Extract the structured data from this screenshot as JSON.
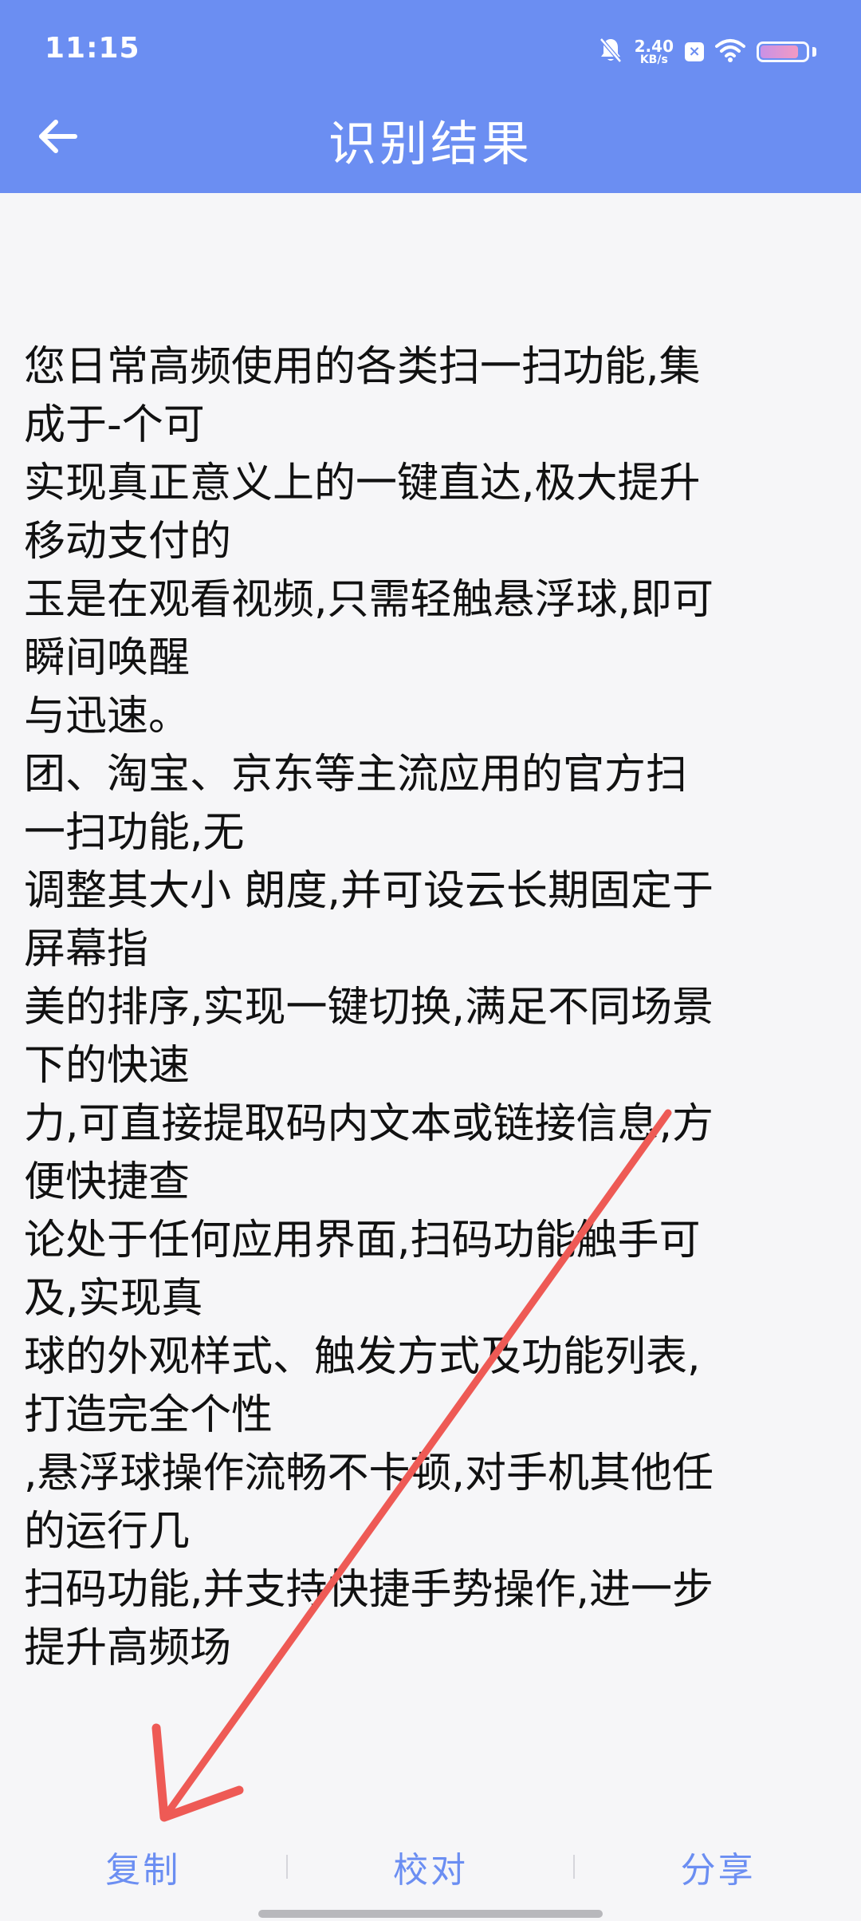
{
  "status_bar": {
    "time": "11:15",
    "net_speed_value": "2.40",
    "net_speed_unit": "KB/s",
    "x_badge": "×",
    "icons": [
      "bell-muted-icon",
      "x-badge-icon",
      "wifi-icon",
      "battery-icon"
    ],
    "battery_level": 0.85
  },
  "app_bar": {
    "back_icon": "back-arrow-icon",
    "title": "识别结果"
  },
  "content": {
    "lines": [
      "您日常高频使用的各类扫一扫功能,集",
      "成于-个可",
      "实现真正意义上的一键直达,极大提升",
      "移动支付的",
      "玉是在观看视频,只需轻触悬浮球,即可",
      "瞬间唤醒",
      "与迅速。",
      "团、淘宝、京东等主流应用的官方扫",
      "一扫功能,无",
      "调整其大小 朗度,并可设云长期固定于",
      "屏幕指",
      "美的排序,实现一键切换,满足不同场景",
      "下的快速",
      "力,可直接提取码内文本或链接信息,方",
      "便快捷查",
      "论处于任何应用界面,扫码功能触手可",
      "及,实现真",
      "球的外观样式、触发方式及功能列表,",
      "打造完全个性",
      ",悬浮球操作流畅不卡顿,对手机其他任",
      "的运行几",
      "扫码功能,并支持快捷手势操作,进一步",
      "提升高频场"
    ]
  },
  "actions": {
    "copy": "复制",
    "proofread": "校对",
    "share": "分享"
  },
  "colors": {
    "primary": "#6b8ef2",
    "background": "#f6f6f8",
    "text": "#111111",
    "annotation_arrow": "#ee5a55"
  }
}
